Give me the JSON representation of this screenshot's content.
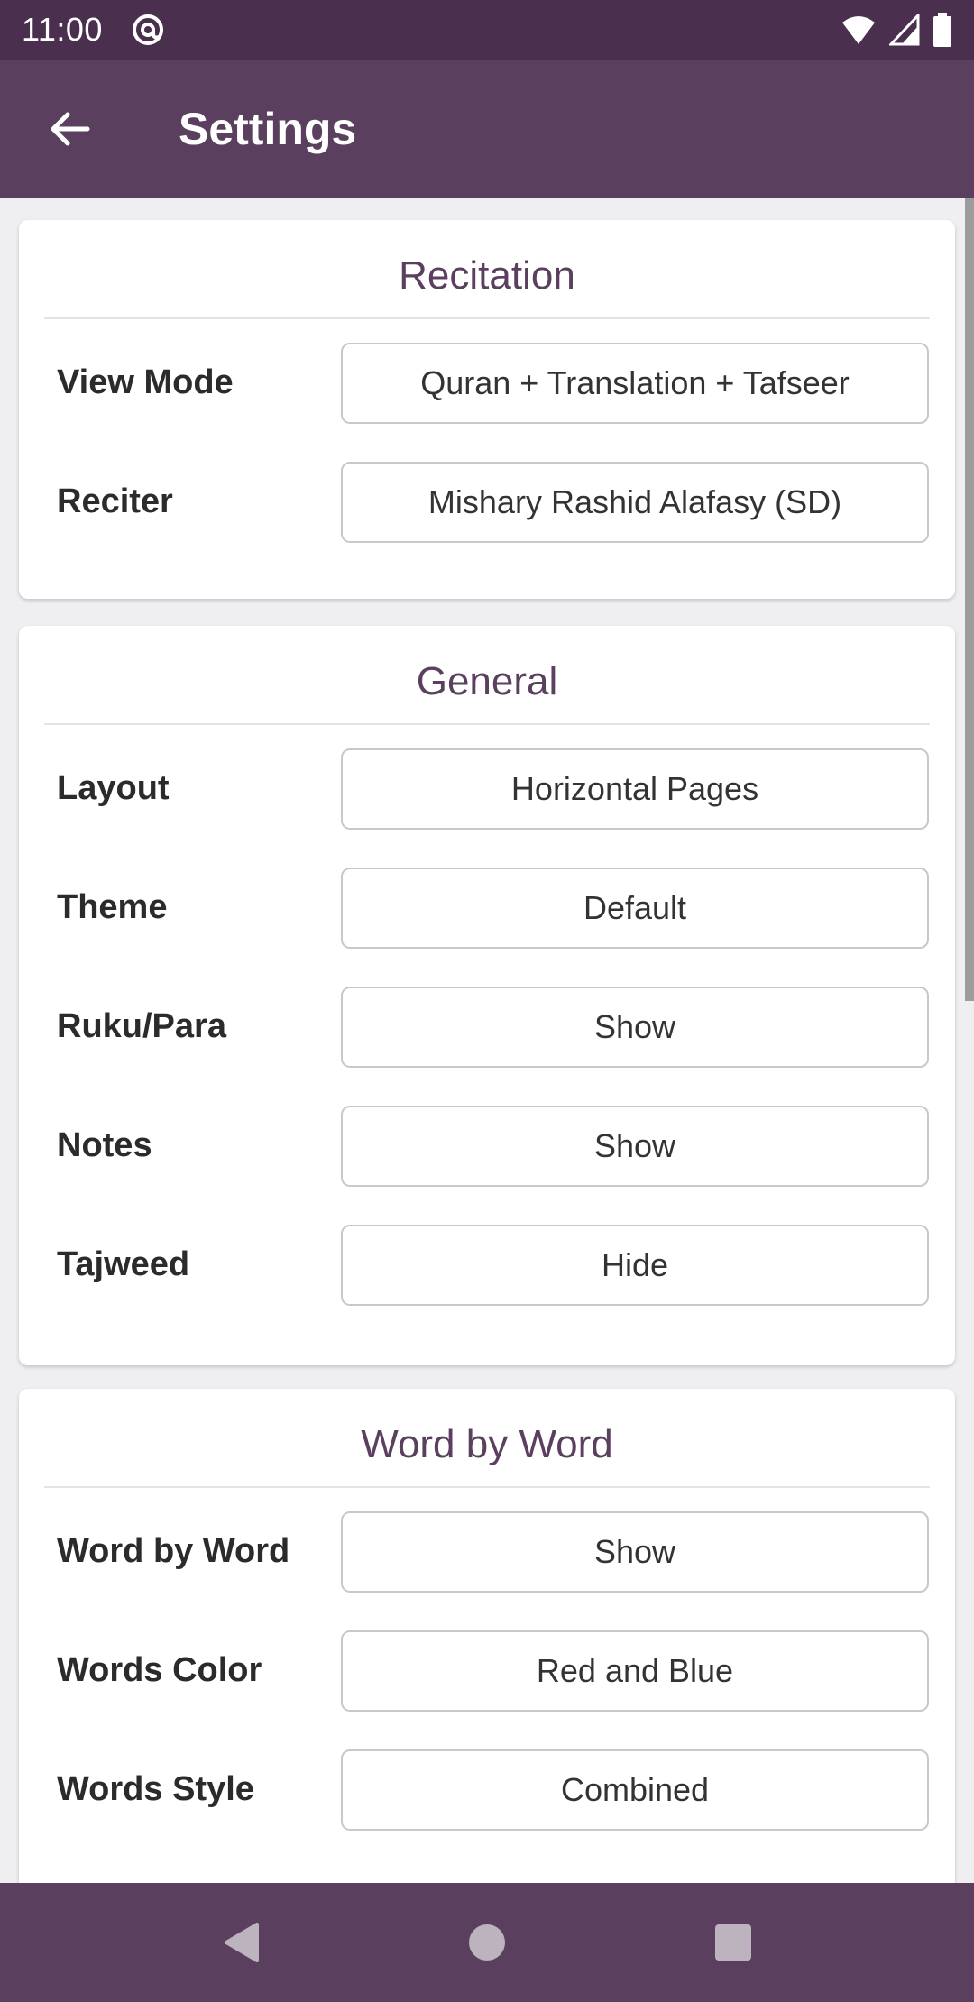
{
  "status_bar": {
    "time": "11:00"
  },
  "app_bar": {
    "title": "Settings"
  },
  "sections": [
    {
      "title": "Recitation",
      "rows": [
        {
          "label": "View Mode",
          "value": "Quran + Translation + Tafseer"
        },
        {
          "label": "Reciter",
          "value": "Mishary Rashid Alafasy (SD)"
        }
      ]
    },
    {
      "title": "General",
      "rows": [
        {
          "label": "Layout",
          "value": "Horizontal Pages"
        },
        {
          "label": "Theme",
          "value": "Default"
        },
        {
          "label": "Ruku/Para",
          "value": "Show"
        },
        {
          "label": "Notes",
          "value": "Show"
        },
        {
          "label": "Tajweed",
          "value": "Hide"
        }
      ]
    },
    {
      "title": "Word by Word",
      "rows": [
        {
          "label": "Word by Word",
          "value": "Show"
        },
        {
          "label": "Words Color",
          "value": "Red and Blue"
        },
        {
          "label": "Words Style",
          "value": "Combined"
        }
      ]
    }
  ],
  "colors": {
    "app_bar": "#5b3f5f",
    "status_bar": "#4a2f4f",
    "section_title": "#5b3f5f"
  },
  "icons": {
    "back": "arrow-left-icon",
    "nav_back": "triangle-back-icon",
    "nav_home": "circle-home-icon",
    "nav_recents": "square-recents-icon"
  }
}
